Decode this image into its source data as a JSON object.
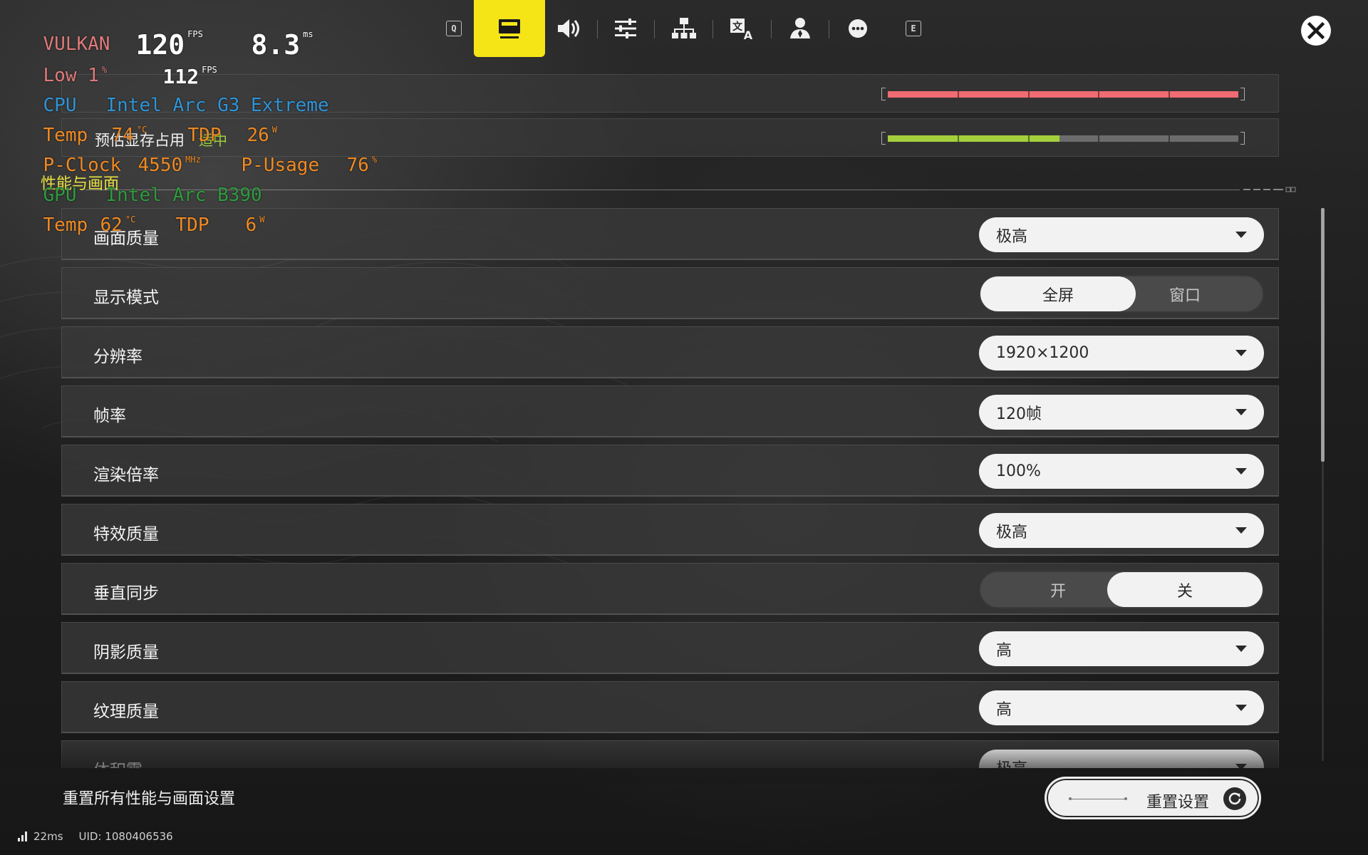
{
  "tabs": {
    "left_key": "Q",
    "right_key": "E",
    "items": [
      {
        "icon": "monitor-icon",
        "active": true
      },
      {
        "icon": "speaker-icon",
        "active": false
      },
      {
        "icon": "sliders-icon",
        "active": false
      },
      {
        "icon": "network-icon",
        "active": false
      },
      {
        "icon": "language-icon",
        "active": false
      },
      {
        "icon": "account-icon",
        "active": false
      },
      {
        "icon": "more-icon",
        "active": false
      }
    ]
  },
  "info_bars": [
    {
      "label": "",
      "status": "",
      "fill_fraction": 1.0,
      "fill_color": "#f06b72"
    },
    {
      "label": "预估显存占用",
      "status": "适中",
      "fill_fraction": 0.49,
      "fill_color": "#a3cf3c"
    }
  ],
  "section": {
    "title": "性能与画面"
  },
  "settings": [
    {
      "label": "画面质量",
      "type": "dropdown",
      "value": "极高"
    },
    {
      "label": "显示模式",
      "type": "segment",
      "options": [
        "全屏",
        "窗口"
      ],
      "selected": 0
    },
    {
      "label": "分辨率",
      "type": "dropdown",
      "value": "1920×1200"
    },
    {
      "label": "帧率",
      "type": "dropdown",
      "value": "120帧"
    },
    {
      "label": "渲染倍率",
      "type": "dropdown",
      "value": "100%"
    },
    {
      "label": "特效质量",
      "type": "dropdown",
      "value": "极高"
    },
    {
      "label": "垂直同步",
      "type": "segment",
      "options": [
        "开",
        "关"
      ],
      "selected": 1
    },
    {
      "label": "阴影质量",
      "type": "dropdown",
      "value": "高"
    },
    {
      "label": "纹理质量",
      "type": "dropdown",
      "value": "高"
    },
    {
      "label": "体积雾",
      "type": "dropdown",
      "value": "极高"
    }
  ],
  "footer": {
    "hint": "重置所有性能与画面设置",
    "reset_label": "重置设置",
    "ping": "22ms",
    "uid": "UID: 1080406536"
  },
  "osd": {
    "api": "VULKAN",
    "fps": "120",
    "fps_unit": "FPS",
    "frametime": "8.3",
    "frametime_unit": "ms",
    "low_label": "Low 1",
    "low_unit": "%",
    "low_fps": "112",
    "low_fps_unit": "FPS",
    "cpu_label": "CPU",
    "cpu_name": "Intel Arc G3 Extreme",
    "cpu_temp_label": "Temp",
    "cpu_temp": "74",
    "temp_unit": "°C",
    "tdp_label": "TDP",
    "cpu_tdp": "26",
    "tdp_unit": "W",
    "pclock_label": "P-Clock",
    "pclock": "4550",
    "pclock_unit": "MHz",
    "pusage_label": "P-Usage",
    "pusage": "76",
    "pusage_unit": "%",
    "gpu_label": "GPU",
    "gpu_name": "Intel Arc B390",
    "gpu_temp": "62",
    "gpu_tdp": "6"
  }
}
